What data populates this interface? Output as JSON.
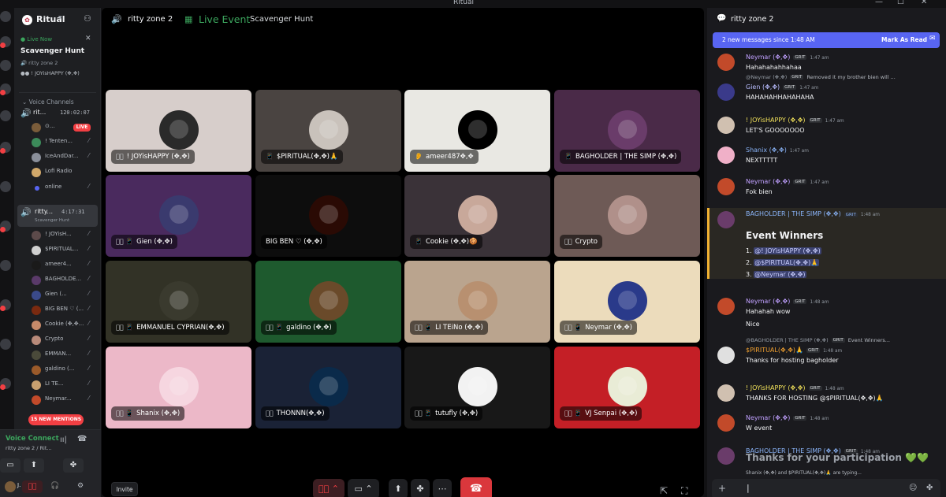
{
  "window": {
    "title": "Ritual"
  },
  "server": {
    "name": "Ritual",
    "chevron": "▾"
  },
  "live_card": {
    "status": "Live Now",
    "title": "Scavenger Hunt",
    "channel": "ritty zone 2",
    "users": "! JOYisHAPPY (✥,✥)"
  },
  "voice_channels_label": "Voice Channels",
  "channels": [
    {
      "name": "rit...",
      "time": "120:02:07",
      "users": [
        {
          "name": "⊙...",
          "live": "LIVE",
          "color": "#7a5c3a"
        },
        {
          "name": "! Tenten...",
          "color": "#3c8b5a"
        },
        {
          "name": "IceAndDar...",
          "color": "#8a8f9a"
        },
        {
          "name": "Lofi Radio",
          "color": "#d1a86a"
        },
        {
          "name": "online",
          "color": "#5865f2"
        }
      ]
    },
    {
      "name": "ritty...",
      "time": "4:17:31",
      "sub": "Scavenger Hunt",
      "users": [
        {
          "name": "! JOYisH...",
          "color": "#5c4a4a"
        },
        {
          "name": "$PIRITUAL...",
          "color": "#d0d0d0"
        },
        {
          "name": "ameer4...",
          "color": "#1a1a1a"
        },
        {
          "name": "BAGHOLDE...",
          "color": "#5a3a6a"
        },
        {
          "name": "Gien (...",
          "color": "#3a4a8a"
        },
        {
          "name": "BIG BEN ♡ (...",
          "color": "#7a2a10"
        },
        {
          "name": "Cookie (✥,✥...",
          "color": "#c78a6a"
        },
        {
          "name": "Crypto",
          "color": "#b88a7a"
        },
        {
          "name": "EMMAN...",
          "color": "#4a4a3a"
        },
        {
          "name": "galdino (...",
          "color": "#9a5a2a"
        },
        {
          "name": "LI TE...",
          "color": "#c8a070"
        },
        {
          "name": "Neymar...",
          "color": "#c24a2a"
        }
      ]
    }
  ],
  "mentions": "15 NEW MENTIONS",
  "voice_panel": {
    "status": "Voice Connect",
    "location": "ritty zone 2 / Rit..."
  },
  "user_panel": {
    "name": "J."
  },
  "stage": {
    "channel": "ritty zone 2",
    "event_label": "Live Event",
    "event_name": "Scavenger Hunt",
    "invite": "Invite"
  },
  "tiles": [
    {
      "name": "! JOYisHAPPY (✥,✥)",
      "bg": "#d7cecb",
      "icon": "🎤⃠",
      "av": "#2a2a2a"
    },
    {
      "name": "$PIRITUAL(✥,✥)🙏",
      "bg": "#4a4441",
      "icon": "📱",
      "av": "#c9c2bb"
    },
    {
      "name": "ameer487✥,✥",
      "bg": "#e9e8e3",
      "icon": "👂",
      "av": "#000000"
    },
    {
      "name": "BAGHOLDER | THE SIMP (✥,✥)",
      "bg": "#4a2a48",
      "icon": "📱",
      "av": "#6a3c6a"
    },
    {
      "name": "Gien (✥,✥)",
      "bg": "#4a2a5e",
      "icon": "🎤⃠ 📱",
      "av": "#3a3a6e"
    },
    {
      "name": "BIG BEN ♡ (✥,✥)",
      "bg": "#0d0d0d",
      "icon": "",
      "av": "#2a0a04"
    },
    {
      "name": "Cookie (✥,✥)🍪",
      "bg": "#3a3238",
      "icon": "📱",
      "av": "#c8a89a"
    },
    {
      "name": "Crypto",
      "bg": "#6e5a56",
      "icon": "🎤⃠",
      "av": "#b0908a"
    },
    {
      "name": "EMMANUEL CYPRIAN(✥,✥)",
      "bg": "#323226",
      "icon": "🎤⃠ 📱",
      "av": "#3a3a2e"
    },
    {
      "name": "galdino (✥,✥)",
      "bg": "#1e5a2e",
      "icon": "🎤⃠ 📱",
      "av": "#6a4a2a"
    },
    {
      "name": "LI TEiNo (✥,✥)",
      "bg": "#baa48e",
      "icon": "🎤⃠ 📱",
      "av": "#b89070"
    },
    {
      "name": "Neymar (✥,✥)",
      "bg": "#ecdcbc",
      "icon": "🎤⃠ 📱",
      "av": "#2a3a8a"
    },
    {
      "name": "Shanix (✥,✥)",
      "bg": "#ecb8c8",
      "icon": "🎤⃠ 📱",
      "av": "#f6d6e0"
    },
    {
      "name": "THONNN(✥,✥)",
      "bg": "#1a2236",
      "icon": "🎤⃠",
      "av": "#0a2a4a"
    },
    {
      "name": "tutufly (✥,✥)",
      "bg": "#181818",
      "icon": "🎤⃠ 📱",
      "av": "#f2f2f2"
    },
    {
      "name": "VJ Senpai (✥,✥)",
      "bg": "#c41f26",
      "icon": "🎤⃠ 📱",
      "av": "#e9ecd6"
    }
  ],
  "chat": {
    "title": "ritty zone 2",
    "new_messages": "2 new messages since 1:48 AM",
    "mark_read": "Mark As Read",
    "messages": [
      {
        "user": "Neymar (✥,✥)",
        "color": "#c0a0ff",
        "tag": "GRIT",
        "time": "1:47 am",
        "text": "Hahahahahhahaa",
        "av": "#c24a2a"
      },
      {
        "reply_user": "@Neymar (✥,✥)",
        "reply_tag": "GRIT",
        "reply_text": "Removed it my brother bien will ...",
        "user": "Gien (✥,✥)",
        "color": "#b9bdff",
        "tag": "GRIT",
        "time": "1:47 am",
        "text": "HAHAHAHHAHAHAHA",
        "av": "#3a3a8a"
      },
      {
        "user": "! JOYisHAPPY (✥,✥)",
        "color": "#f0e05a",
        "tag": "GRIT",
        "time": "1:47 am",
        "text": "LET'S GOOOOOOO",
        "av": "#d0c0b0"
      },
      {
        "user": "Shanix (✥,✥)",
        "color": "#8ab4f8",
        "tag": "",
        "time": "1:47 am",
        "text": "NEXTTTTT",
        "av": "#f0b0c8"
      },
      {
        "user": "Neymar (✥,✥)",
        "color": "#c0a0ff",
        "tag": "GRIT",
        "time": "1:47 am",
        "text": "Fok bien",
        "av": "#c24a2a"
      }
    ],
    "winners": {
      "user": "BAGHOLDER | THE SIMP (✥,✥)",
      "tag": "GRIT",
      "time": "1:48 am",
      "heading": "Event Winners",
      "items": [
        "@! JOYisHAPPY (✥,✥)",
        "@$PIRITUAL(✥,✥)🙏",
        "@Neymar (✥,✥)"
      ]
    },
    "messages2": [
      {
        "user": "Neymar (✥,✥)",
        "color": "#c0a0ff",
        "tag": "GRIT",
        "time": "1:48 am",
        "text": "Hahahah wow",
        "text2": "Nice",
        "av": "#c24a2a"
      },
      {
        "reply_user": "@BAGHOLDER | THE SIMP (✥,✥)",
        "reply_tag": "GRIT",
        "reply_text": "Event Winners...",
        "user": "$PIRITUAL(✥,✥)🙏",
        "color": "#f0a030",
        "tag": "GRIT",
        "time": "1:48 am",
        "text": "Thanks for hosting bagholder",
        "av": "#e0e0e0"
      },
      {
        "user": "! JOYisHAPPY (✥,✥)",
        "color": "#f0e05a",
        "tag": "GRIT",
        "time": "1:48 am",
        "text": "THANKS FOR HOSTING @$PIRITUAL(✥,✥)🙏",
        "av": "#d0c0b0"
      },
      {
        "user": "Neymar (✥,✥)",
        "color": "#c0a0ff",
        "tag": "GRIT",
        "time": "1:48 am",
        "text": "W event",
        "av": "#c24a2a"
      },
      {
        "user": "BAGHOLDER | THE SIMP (✥,✥)",
        "color": "#8ab4f8",
        "tag": "GRIT",
        "time": "1:48 am",
        "text": "",
        "av": "#6a3c6a"
      }
    ],
    "big_thanks": "Thanks for your participation 💚💚",
    "typing": "Shanix (✥,✥) and $PIRITUAL(✥,✥)🙏 are typing...",
    "composer_cursor": "|"
  }
}
